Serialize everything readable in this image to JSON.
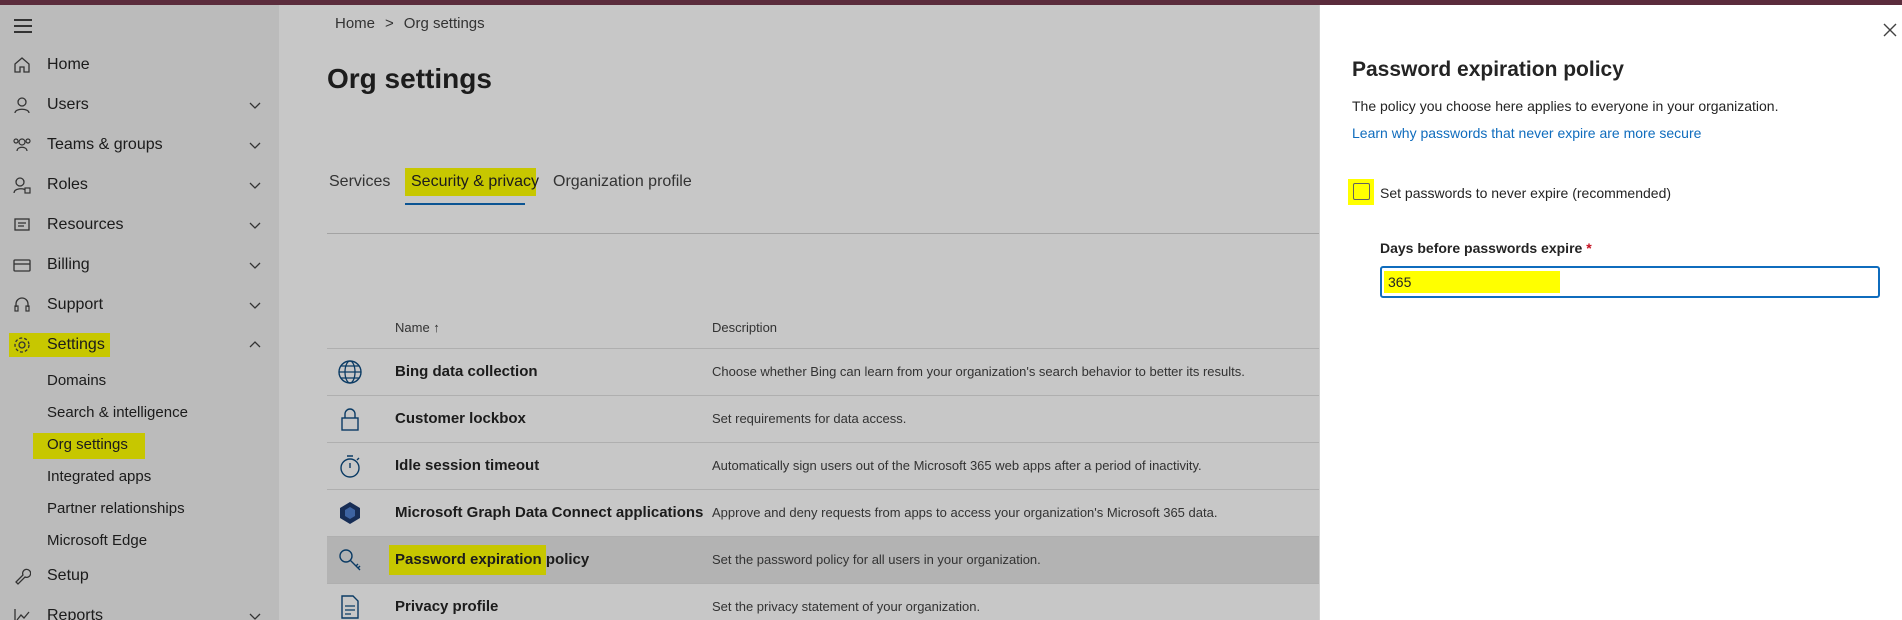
{
  "colors": {
    "topbar": "#5b2c3c",
    "accent": "#0f6cbd",
    "highlight": "#ffff00",
    "required": "#c50f1f"
  },
  "nav": {
    "items": [
      {
        "label": "Home",
        "icon": "home-icon"
      },
      {
        "label": "Users",
        "icon": "user-icon"
      },
      {
        "label": "Teams & groups",
        "icon": "teams-icon"
      },
      {
        "label": "Roles",
        "icon": "roles-icon"
      },
      {
        "label": "Resources",
        "icon": "resources-icon"
      },
      {
        "label": "Billing",
        "icon": "billing-icon"
      },
      {
        "label": "Support",
        "icon": "support-icon"
      },
      {
        "label": "Settings",
        "icon": "gear-icon"
      },
      {
        "label": "Setup",
        "icon": "wrench-icon"
      },
      {
        "label": "Reports",
        "icon": "chart-icon"
      }
    ],
    "settings_sub": [
      "Domains",
      "Search & intelligence",
      "Org settings",
      "Integrated apps",
      "Partner relationships",
      "Microsoft Edge"
    ]
  },
  "breadcrumb": {
    "home": "Home",
    "separator": ">",
    "current": "Org settings"
  },
  "page_title": "Org settings",
  "tabs": [
    "Services",
    "Security & privacy",
    "Organization profile"
  ],
  "table": {
    "col_name": "Name ↑",
    "col_desc": "Description",
    "rows": [
      {
        "name": "Bing data collection",
        "desc": "Choose whether Bing can learn from your organization's search behavior to better its results.",
        "icon": "globe-icon"
      },
      {
        "name": "Customer lockbox",
        "desc": "Set requirements for data access.",
        "icon": "lock-icon"
      },
      {
        "name": "Idle session timeout",
        "desc": "Automatically sign users out of the Microsoft 365 web apps after a period of inactivity.",
        "icon": "timer-icon"
      },
      {
        "name": "Microsoft Graph Data Connect applications",
        "desc": "Approve and deny requests from apps to access your organization's Microsoft 365 data.",
        "icon": "graph-icon"
      },
      {
        "name": "Password expiration policy",
        "desc": "Set the password policy for all users in your organization.",
        "icon": "key-icon"
      },
      {
        "name": "Privacy profile",
        "desc": "Set the privacy statement of your organization.",
        "icon": "document-icon"
      }
    ]
  },
  "panel": {
    "title": "Password expiration policy",
    "description": "The policy you choose here applies to everyone in your organization.",
    "link": "Learn why passwords that never expire are more secure",
    "checkbox_label": "Set passwords to never expire (recommended)",
    "field_label": "Days before passwords expire",
    "required_mark": "*",
    "field_value": "365"
  }
}
